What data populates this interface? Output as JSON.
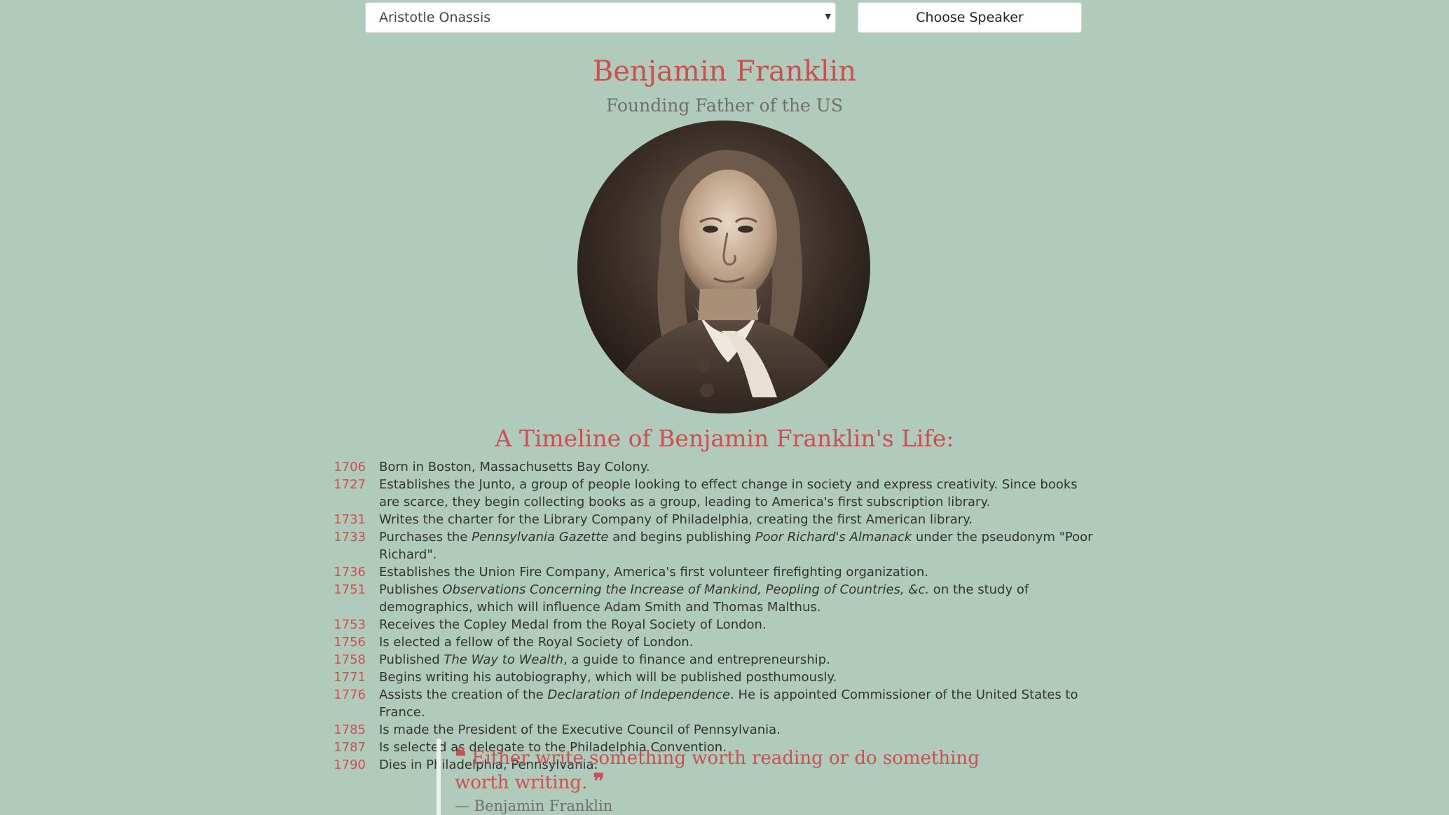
{
  "controls": {
    "speaker_select_value": "Aristotle Onassis",
    "choose_button_label": "Choose Speaker"
  },
  "speaker": {
    "name": "Benjamin Franklin",
    "tagline": "Founding Father of the US"
  },
  "timeline": {
    "title": "A Timeline of Benjamin Franklin's Life:",
    "entries": [
      {
        "year": "1706",
        "parts": [
          "Born in Boston, Massachusetts Bay Colony."
        ]
      },
      {
        "year": "1727",
        "parts": [
          "Establishes the Junto, a group of people looking to effect change in society and express creativity. Since books are scarce, they begin collecting books as a group, leading to America's first subscription library."
        ]
      },
      {
        "year": "1731",
        "parts": [
          "Writes the charter for the Library Company of Philadelphia, creating the first American library."
        ]
      },
      {
        "year": "1733",
        "parts": [
          "Purchases the ",
          "Pennsylvania Gazette",
          " and begins publishing ",
          "Poor Richard's Almanack",
          " under the pseudonym \"Poor Richard\"."
        ]
      },
      {
        "year": "1736",
        "parts": [
          "Establishes the Union Fire Company, America's first volunteer firefighting organization."
        ]
      },
      {
        "year": "1751",
        "parts": [
          "Publishes ",
          "Observations Concerning the Increase of Mankind, Peopling of Countries, &c.",
          " on the study of demographics, which will influence Adam Smith and Thomas Malthus."
        ]
      },
      {
        "year": "1753",
        "parts": [
          "Receives the Copley Medal from the Royal Society of London."
        ]
      },
      {
        "year": "1756",
        "parts": [
          "Is elected a fellow of the Royal Society of London."
        ]
      },
      {
        "year": "1758",
        "parts": [
          "Published ",
          "The Way to Wealth",
          ", a guide to finance and entrepreneurship."
        ]
      },
      {
        "year": "1771",
        "parts": [
          "Begins writing his autobiography, which will be published posthumously."
        ]
      },
      {
        "year": "1776",
        "parts": [
          "Assists the creation of the ",
          "Declaration of Independence",
          ". He is appointed Commissioner of the United States to France."
        ]
      },
      {
        "year": "1785",
        "parts": [
          "Is made the President of the Executive Council of Pennsylvania."
        ]
      },
      {
        "year": "1787",
        "parts": [
          "Is selected as delegate to the Philadelphia Convention."
        ]
      },
      {
        "year": "1790",
        "parts": [
          "Dies in Philadelphia, Pennsylvania."
        ]
      }
    ]
  },
  "quote": {
    "text": "Either write something worth reading or do something worth writing.",
    "author": "— Benjamin Franklin"
  },
  "colors": {
    "background": "#b0cbbb",
    "accent": "#cd4f4f",
    "muted": "#6f6f6f"
  },
  "icons": {
    "quote_open": "quote-left-icon",
    "quote_close": "quote-right-icon",
    "select_caret": "caret-down-icon"
  }
}
